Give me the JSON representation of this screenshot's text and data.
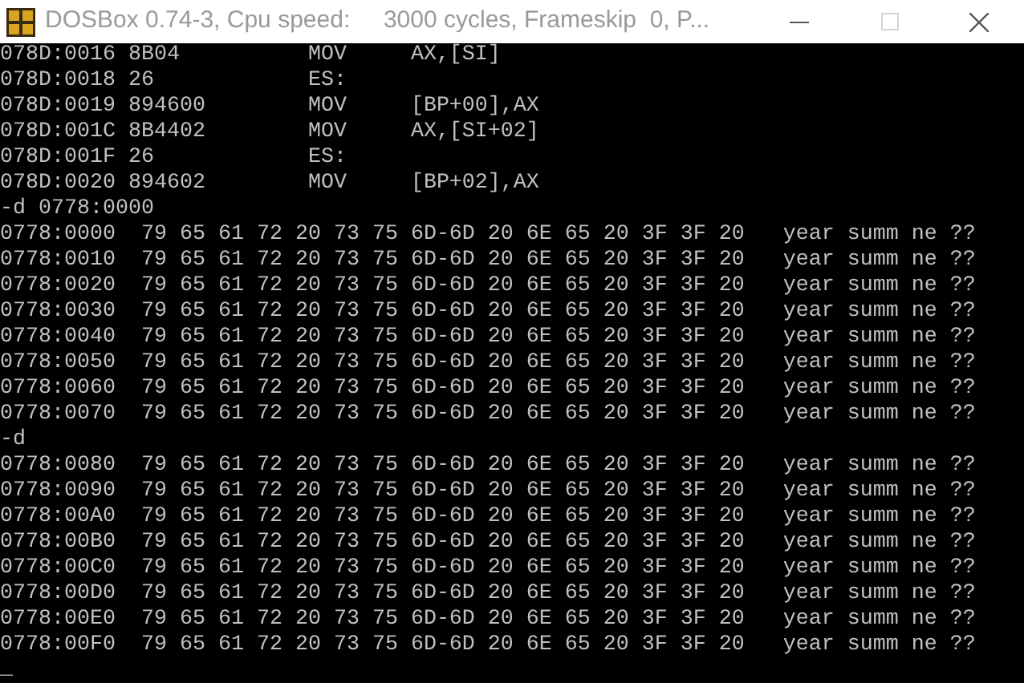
{
  "window": {
    "title": "DOSBox 0.74-3, Cpu speed:     3000 cycles, Frameskip  0, P...",
    "controls": [
      {
        "kind": "minimize",
        "disabled": false
      },
      {
        "kind": "maximize",
        "disabled": true
      },
      {
        "kind": "close",
        "disabled": false
      }
    ]
  },
  "terminal": {
    "lines": [
      "078D:0016 8B04          MOV     AX,[SI]",
      "078D:0018 26            ES:",
      "078D:0019 894600        MOV     [BP+00],AX",
      "078D:001C 8B4402        MOV     AX,[SI+02]",
      "078D:001F 26            ES:",
      "078D:0020 894602        MOV     [BP+02],AX",
      "-d 0778:0000",
      "0778:0000  79 65 61 72 20 73 75 6D-6D 20 6E 65 20 3F 3F 20   year summ ne ??",
      "0778:0010  79 65 61 72 20 73 75 6D-6D 20 6E 65 20 3F 3F 20   year summ ne ??",
      "0778:0020  79 65 61 72 20 73 75 6D-6D 20 6E 65 20 3F 3F 20   year summ ne ??",
      "0778:0030  79 65 61 72 20 73 75 6D-6D 20 6E 65 20 3F 3F 20   year summ ne ??",
      "0778:0040  79 65 61 72 20 73 75 6D-6D 20 6E 65 20 3F 3F 20   year summ ne ??",
      "0778:0050  79 65 61 72 20 73 75 6D-6D 20 6E 65 20 3F 3F 20   year summ ne ??",
      "0778:0060  79 65 61 72 20 73 75 6D-6D 20 6E 65 20 3F 3F 20   year summ ne ??",
      "0778:0070  79 65 61 72 20 73 75 6D-6D 20 6E 65 20 3F 3F 20   year summ ne ??",
      "-d",
      "0778:0080  79 65 61 72 20 73 75 6D-6D 20 6E 65 20 3F 3F 20   year summ ne ??",
      "0778:0090  79 65 61 72 20 73 75 6D-6D 20 6E 65 20 3F 3F 20   year summ ne ??",
      "0778:00A0  79 65 61 72 20 73 75 6D-6D 20 6E 65 20 3F 3F 20   year summ ne ??",
      "0778:00B0  79 65 61 72 20 73 75 6D-6D 20 6E 65 20 3F 3F 20   year summ ne ??",
      "0778:00C0  79 65 61 72 20 73 75 6D-6D 20 6E 65 20 3F 3F 20   year summ ne ??",
      "0778:00D0  79 65 61 72 20 73 75 6D-6D 20 6E 65 20 3F 3F 20   year summ ne ??",
      "0778:00E0  79 65 61 72 20 73 75 6D-6D 20 6E 65 20 3F 3F 20   year summ ne ??",
      "0778:00F0  79 65 61 72 20 73 75 6D-6D 20 6E 65 20 3F 3F 20   year summ ne ??"
    ],
    "cursor": "_"
  }
}
